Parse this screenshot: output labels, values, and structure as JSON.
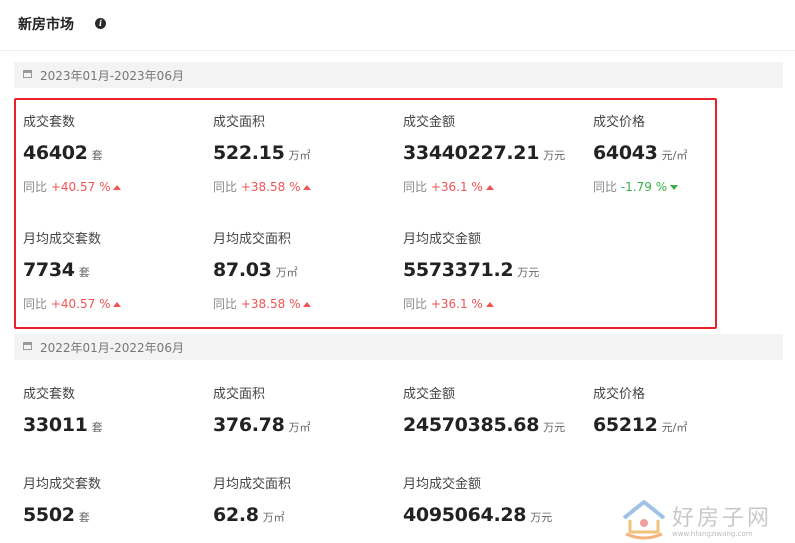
{
  "header": {
    "title": "新房市场",
    "info_icon": "info-icon"
  },
  "period_2023": {
    "range": "2023年01月-2023年06月",
    "metrics": [
      {
        "label": "成交套数",
        "value": "46402",
        "unit": "套",
        "yoy_label": "同比",
        "yoy_value": "+40.57 %",
        "trend": "up"
      },
      {
        "label": "成交面积",
        "value": "522.15",
        "unit": "万㎡",
        "yoy_label": "同比",
        "yoy_value": "+38.58 %",
        "trend": "up"
      },
      {
        "label": "成交金额",
        "value": "33440227.21",
        "unit": "万元",
        "yoy_label": "同比",
        "yoy_value": "+36.1 %",
        "trend": "up"
      },
      {
        "label": "成交价格",
        "value": "64043",
        "unit": "元/㎡",
        "yoy_label": "同比",
        "yoy_value": "-1.79 %",
        "trend": "down"
      },
      {
        "label": "月均成交套数",
        "value": "7734",
        "unit": "套",
        "yoy_label": "同比",
        "yoy_value": "+40.57 %",
        "trend": "up"
      },
      {
        "label": "月均成交面积",
        "value": "87.03",
        "unit": "万㎡",
        "yoy_label": "同比",
        "yoy_value": "+38.58 %",
        "trend": "up"
      },
      {
        "label": "月均成交金额",
        "value": "5573371.2",
        "unit": "万元",
        "yoy_label": "同比",
        "yoy_value": "+36.1 %",
        "trend": "up"
      }
    ]
  },
  "period_2022": {
    "range": "2022年01月-2022年06月",
    "metrics": [
      {
        "label": "成交套数",
        "value": "33011",
        "unit": "套"
      },
      {
        "label": "成交面积",
        "value": "376.78",
        "unit": "万㎡"
      },
      {
        "label": "成交金额",
        "value": "24570385.68",
        "unit": "万元"
      },
      {
        "label": "成交价格",
        "value": "65212",
        "unit": "元/㎡"
      },
      {
        "label": "月均成交套数",
        "value": "5502",
        "unit": "套"
      },
      {
        "label": "月均成交面积",
        "value": "62.8",
        "unit": "万㎡"
      },
      {
        "label": "月均成交金额",
        "value": "4095064.28",
        "unit": "万元"
      }
    ]
  },
  "watermark": {
    "brand": "好房子网",
    "url": "www.hfangziwang.com"
  },
  "colors": {
    "up": "#f05454",
    "down": "#36b04a",
    "highlight_border": "#e8202a"
  }
}
